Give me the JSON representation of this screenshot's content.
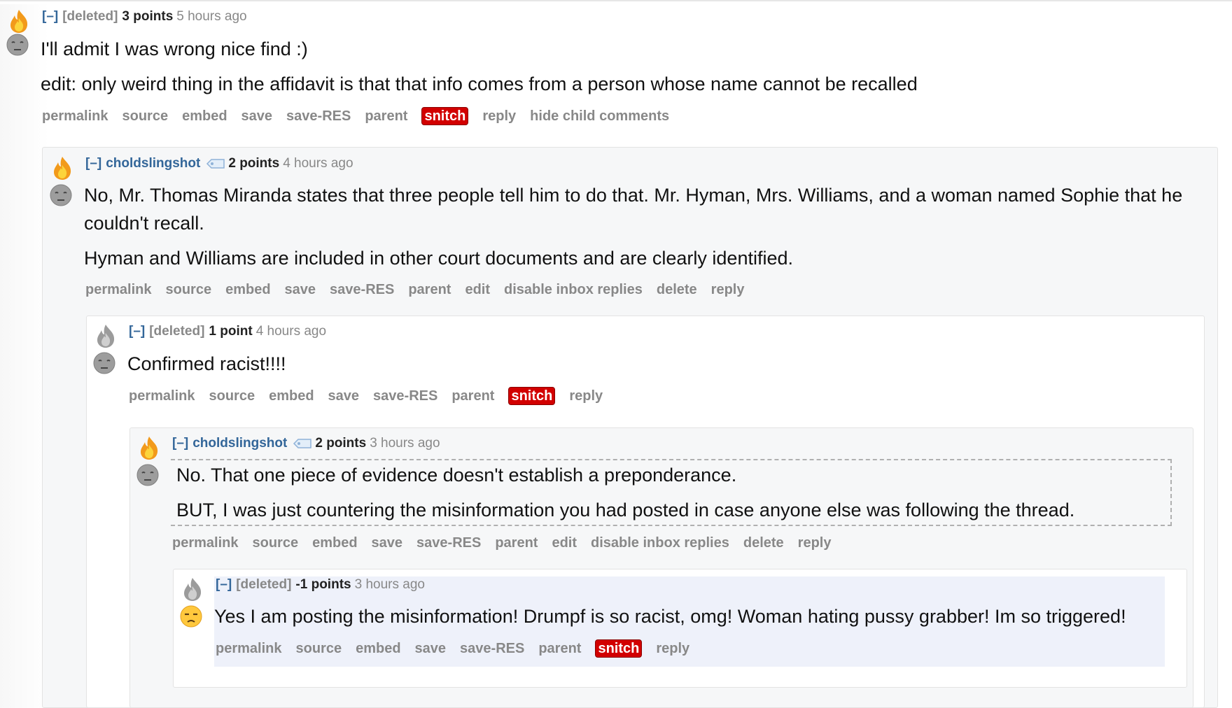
{
  "comments": [
    {
      "toggle": "[–]",
      "author": "[deleted]",
      "score": "3 points",
      "time": "5 hours ago",
      "body": [
        "I'll admit I was wrong nice find :)",
        "edit: only weird thing in the affidavit is that that info comes from a person whose name cannot be recalled"
      ],
      "buttons": [
        "permalink",
        "source",
        "embed",
        "save",
        "save-RES",
        "parent",
        "snitch",
        "reply",
        "hide child comments"
      ]
    },
    {
      "toggle": "[–]",
      "author": "choldslingshot",
      "score": "2 points",
      "time": "4 hours ago",
      "body": [
        "No, Mr. Thomas Miranda states that three people tell him to do that. Mr. Hyman, Mrs. Williams, and a woman named Sophie that he couldn't recall.",
        "Hyman and Williams are included in other court documents and are clearly identified."
      ],
      "buttons": [
        "permalink",
        "source",
        "embed",
        "save",
        "save-RES",
        "parent",
        "edit",
        "disable inbox replies",
        "delete",
        "reply"
      ]
    },
    {
      "toggle": "[–]",
      "author": "[deleted]",
      "score": "1 point",
      "time": "4 hours ago",
      "body": [
        "Confirmed racist!!!!"
      ],
      "buttons": [
        "permalink",
        "source",
        "embed",
        "save",
        "save-RES",
        "parent",
        "snitch",
        "reply"
      ]
    },
    {
      "toggle": "[–]",
      "author": "choldslingshot",
      "score": "2 points",
      "time": "3 hours ago",
      "body": [
        "No. That one piece of evidence doesn't establish a preponderance.",
        "BUT, I was just countering the misinformation you had posted in case anyone else was following the thread."
      ],
      "buttons": [
        "permalink",
        "source",
        "embed",
        "save",
        "save-RES",
        "parent",
        "edit",
        "disable inbox replies",
        "delete",
        "reply"
      ]
    },
    {
      "toggle": "[–]",
      "author": "[deleted]",
      "score": "-1 points",
      "time": "3 hours ago",
      "body": [
        "Yes I am posting the misinformation! Drumpf is so racist, omg! Woman hating pussy grabber! Im so triggered!"
      ],
      "buttons": [
        "permalink",
        "source",
        "embed",
        "save",
        "save-RES",
        "parent",
        "snitch",
        "reply"
      ]
    }
  ],
  "icons": {
    "fire": "fire-icon",
    "fire_grey": "grey-fire-icon",
    "face_neutral": "neutral-face-icon",
    "face_unamused": "unamused-face-icon",
    "tag": "user-tag-icon"
  },
  "colors": {
    "link_blue": "#336699",
    "snitch_red": "#d20000",
    "button_grey": "#888888",
    "highlight": "#eef1fa"
  }
}
